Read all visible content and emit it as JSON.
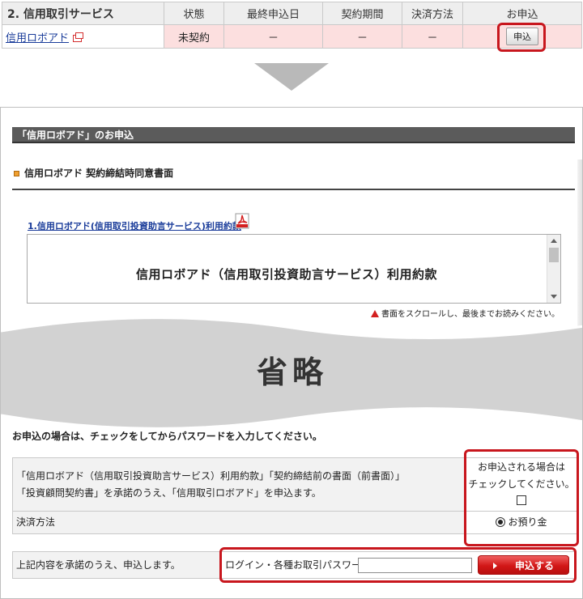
{
  "service_table": {
    "headers": [
      "2. 信用取引サービス",
      "状態",
      "最終申込日",
      "契約期間",
      "決済方法",
      "お申込"
    ],
    "row": {
      "service_name": "信用ロボアド",
      "status": "未契約",
      "last_apply_date": "－",
      "contract_period": "－",
      "settlement": "－",
      "apply_label": "申込"
    }
  },
  "form": {
    "section_title": "「信用ロボアド」のお申込",
    "doc_title": "信用ロボアド 契約締結時同意書面",
    "terms_link": "1.信用ロボアド(信用取引投資助言サービス)利用約款",
    "doc_box_title": "信用ロボアド（信用取引投資助言サービス）利用約款",
    "scroll_note": "書面をスクロールし、最後までお読みください。",
    "omitted_text": "省略",
    "instruction": "お申込の場合は、チェックをしてからパスワードを入力してください。",
    "agree_line1": "「信用ロボアド（信用取引投資助言サービス）利用約款」「契約締結前の書面（前書面）」",
    "agree_line2": "「投資顧問契約書」を承諾のうえ、「信用取引ロボアド」を申込ます。",
    "check_line1": "お申込される場合は",
    "check_line2": "チェックしてください。",
    "settlement_label": "決済方法",
    "settlement_value": "お預り金",
    "confirm_text": "上記内容を承諾のうえ、申込します。",
    "password_label": "ログイン・各種お取引パスワード",
    "password_value": "",
    "submit_label": "申込する"
  },
  "colors": {
    "highlight_red": "#c8161d",
    "row_pink": "#fcdfdf",
    "section_bar": "#5b5b5b",
    "submit_red": "#d21717"
  },
  "icons": [
    "external-link-icon",
    "pdf-icon",
    "warning-icon",
    "scroll-up-icon",
    "scroll-down-icon",
    "triangle-right-icon"
  ]
}
